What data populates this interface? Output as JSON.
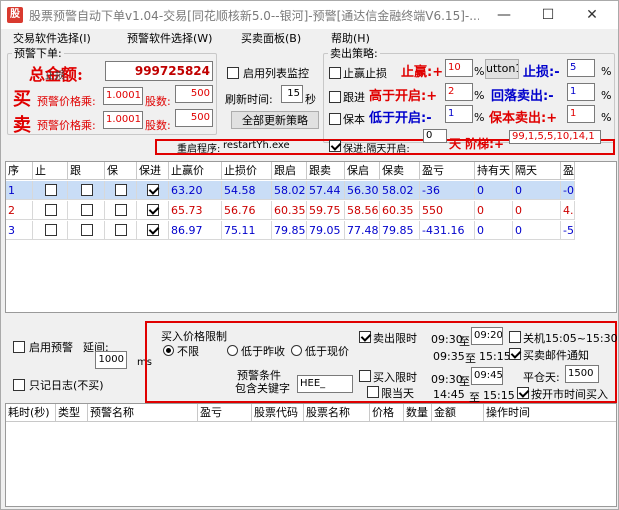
{
  "window": {
    "title": "股票预警自动下单v1.04-交易[同花顺核新5.0--银河]-预警[通达信金融终端V6.15]-...",
    "icon_text": "股",
    "minimize": "—",
    "maximize": "☐",
    "close": "✕"
  },
  "menu": [
    "交易软件选择(I)",
    "预警软件选择(W)",
    "买卖面板(B)",
    "帮助(H)"
  ],
  "alert_order": {
    "legend": "预警下单:",
    "total_label": "总金额:",
    "overlay_label": "止损",
    "total_value": "999725824",
    "buy_big": "买",
    "sell_big": "卖",
    "buy_multiplier_label": "预警价格乘:",
    "buy_multiplier": "1.0001",
    "buy_shares_label": "股数:",
    "buy_shares": "500",
    "sell_multiplier_label": "预警价格乘:",
    "sell_multiplier": "1.0001",
    "sell_shares_label": "股数:",
    "sell_shares": "500"
  },
  "monitor": {
    "enable_label": "启用列表监控",
    "refresh_label": "刷新时间:",
    "refresh_value": "15",
    "refresh_unit": "秒",
    "update_all_button": "全部更新策略"
  },
  "sell_strategy": {
    "legend": "卖出策略:",
    "stop_profit_loss_label": "止赢止损",
    "stop_profit_label": "止赢:+",
    "stop_profit_value": "10",
    "pct": "%",
    "button1": "utton1",
    "stop_loss_label": "止损:-",
    "stop_loss_value": "5",
    "follow_label": "跟进",
    "high_open_label": "高于开启:+",
    "high_open_value": "2",
    "pullback_label": "回落卖出:-",
    "pullback_value": "1",
    "protect_label": "保本",
    "low_open_label": "低于开启:-",
    "low_open_value": "1",
    "protect_sell_label": "保本卖出:+",
    "protect_sell_value": "1",
    "protect_advance_label": "保进:隔天开启:",
    "protect_advance_value": "0",
    "ladder_label": "天 阶梯:+",
    "ladder_value": "99,1,5,5,10,14,1"
  },
  "restart": {
    "label": "重启程序:",
    "value": "restartYh.exe"
  },
  "grid": {
    "headers": [
      "序",
      "止",
      "跟",
      "保",
      "保进",
      "止赢价",
      "止损价",
      "跟启",
      "跟卖",
      "保启",
      "保卖",
      "盈亏",
      "持有天",
      "隔天",
      "盈"
    ],
    "rows": [
      {
        "seq": "1",
        "zhi": false,
        "gen": false,
        "bao": false,
        "baojin": true,
        "stop_profit": "63.20",
        "stop_loss": "54.58",
        "follow_on": "58.02",
        "follow_sell": "57.44",
        "protect_on": "56.30",
        "protect_sell": "58.02",
        "pnl": "-36",
        "hold_days": "0",
        "next_day": "0",
        "extra": "-0"
      },
      {
        "seq": "2",
        "zhi": false,
        "gen": false,
        "bao": false,
        "baojin": true,
        "stop_profit": "65.73",
        "stop_loss": "56.76",
        "follow_on": "60.35",
        "follow_sell": "59.75",
        "protect_on": "58.56",
        "protect_sell": "60.35",
        "pnl": "550",
        "hold_days": "0",
        "next_day": "0",
        "extra": "4."
      },
      {
        "seq": "3",
        "zhi": false,
        "gen": false,
        "bao": false,
        "baojin": true,
        "stop_profit": "86.97",
        "stop_loss": "75.11",
        "follow_on": "79.85",
        "follow_sell": "79.05",
        "protect_on": "77.48",
        "protect_sell": "79.85",
        "pnl": "-431.16",
        "hold_days": "0",
        "next_day": "0",
        "extra": "-5"
      }
    ]
  },
  "bottom_left": {
    "enable_alert_label": "启用预警",
    "delay_label": "延间:",
    "delay_value": "1000",
    "delay_unit": "ms",
    "log_only_label": "只记日志(不买)"
  },
  "buy_panel": {
    "price_limit_label": "买入价格限制",
    "no_limit": "不限",
    "below_prev_close": "低于昨收",
    "below_current": "低于现价",
    "condition_label": "预警条件",
    "keyword_label": "包含关键字",
    "keyword_value": "HEE_",
    "sell_limit_label": "卖出限时",
    "buy_limit_label": "买入限时",
    "limit_today_label": "限当天",
    "t1_from": "09:30",
    "to1": "至",
    "t1_to": "09:20",
    "t2_from": "09:35",
    "to2": "至",
    "t2_to": "15:15",
    "t3_from": "09:30",
    "to3": "至",
    "t3_to": "09:45",
    "t4_from": "14:45",
    "to4": "至",
    "t4_to": "15:15",
    "shutdown_label": "关机15:05~15:30",
    "mail_label": "买卖邮件通知",
    "close_days_label": "平仓天:",
    "close_days_value": "1500",
    "market_open_label": "按开市时间买入"
  },
  "log_grid": {
    "headers": [
      "耗时(秒)",
      "类型",
      "预警名称",
      "盈亏",
      "股票代码",
      "股票名称",
      "价格",
      "数量",
      "金额",
      "操作时间"
    ]
  }
}
